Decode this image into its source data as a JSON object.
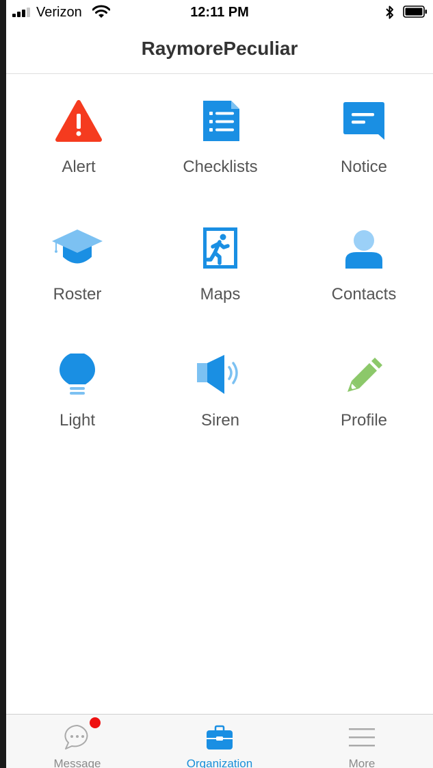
{
  "status_bar": {
    "carrier": "Verizon",
    "time": "12:11 PM"
  },
  "nav": {
    "title": "RaymorePeculiar"
  },
  "grid": {
    "items": [
      {
        "label": "Alert",
        "icon": "alert-triangle-icon",
        "color": "#f53b1f"
      },
      {
        "label": "Checklists",
        "icon": "checklist-document-icon",
        "color": "#1a8fe3"
      },
      {
        "label": "Notice",
        "icon": "notice-message-icon",
        "color": "#1a8fe3"
      },
      {
        "label": "Roster",
        "icon": "graduation-cap-icon",
        "color": "#1a8fe3"
      },
      {
        "label": "Maps",
        "icon": "exit-running-man-icon",
        "color": "#1a8fe3"
      },
      {
        "label": "Contacts",
        "icon": "person-icon",
        "color": "#1a8fe3"
      },
      {
        "label": "Light",
        "icon": "lightbulb-icon",
        "color": "#1a8fe3"
      },
      {
        "label": "Siren",
        "icon": "speaker-icon",
        "color": "#1a8fe3"
      },
      {
        "label": "Profile",
        "icon": "pencil-icon",
        "color": "#8cc86a"
      }
    ]
  },
  "tab_bar": {
    "tabs": [
      {
        "label": "Message",
        "icon": "chat-bubble-icon",
        "active": false,
        "badge": true
      },
      {
        "label": "Organization",
        "icon": "briefcase-icon",
        "active": true,
        "badge": false
      },
      {
        "label": "More",
        "icon": "menu-lines-icon",
        "active": false,
        "badge": false
      }
    ]
  },
  "colors": {
    "accent": "#1a8fd8",
    "alert": "#f53b1f",
    "profile": "#8cc86a",
    "badge": "#ee1111"
  }
}
